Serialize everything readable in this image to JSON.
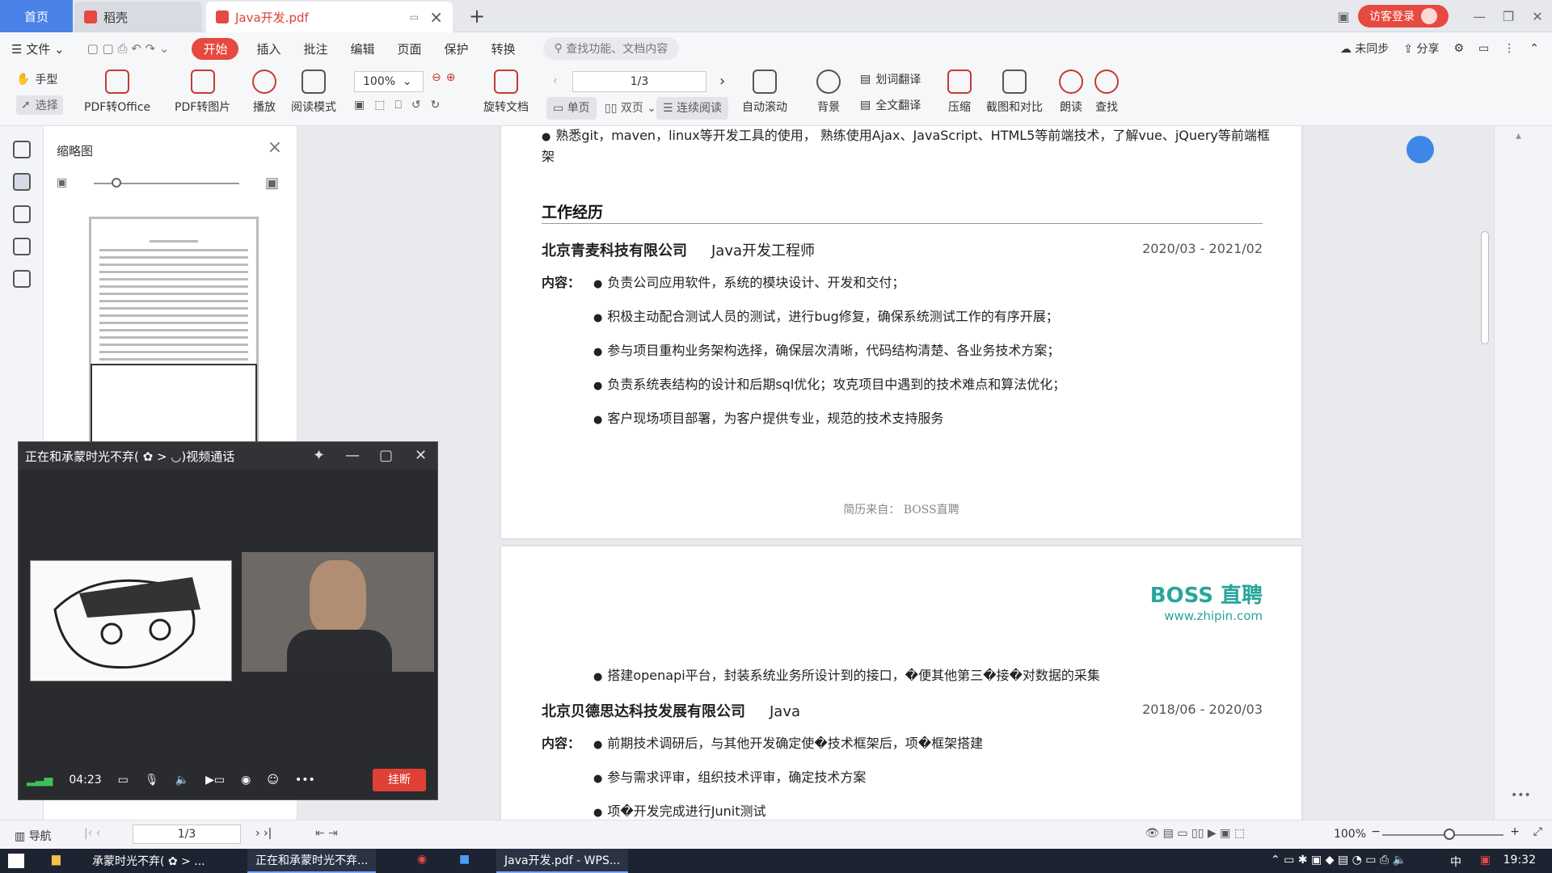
{
  "tabs": {
    "home": "首页",
    "daoke": "稻壳",
    "pdf": "Java开发.pdf",
    "guest_login": "访客登录"
  },
  "menu": {
    "file": "文件",
    "items": [
      "开始",
      "插入",
      "批注",
      "编辑",
      "页面",
      "保护",
      "转换"
    ],
    "search_placeholder": "查找功能、文档内容",
    "sync": "未同步",
    "share": "分享"
  },
  "ribbon": {
    "hand": "手型",
    "select": "选择",
    "pdf_office": "PDF转Office",
    "pdf_image": "PDF转图片",
    "play": "播放",
    "read_mode": "阅读模式",
    "zoom": "100%",
    "page": "1/3",
    "rotate": "旋转文档",
    "single": "单页",
    "double": "双页",
    "continuous": "连续阅读",
    "auto_scroll": "自动滚动",
    "background": "背景",
    "word_translate": "划词翻译",
    "full_translate": "全文翻译",
    "compress": "压缩",
    "screenshot_compare": "截图和对比",
    "read_aloud": "朗读",
    "find": "查找"
  },
  "thumbnails": {
    "title": "缩略图"
  },
  "call": {
    "title": "正在和承蒙时光不弃( ✿ > ◡)视频通话",
    "duration": "04:23",
    "hangup": "挂断"
  },
  "doc": {
    "skill_line": "熟悉git，maven，linux等开发工具的使用， 熟练使用Ajax、JavaScript、HTML5等前端技术，了解vue、jQuery等前端框",
    "skill_line_cont": "架",
    "section_title": "工作经历",
    "job1": {
      "company": "北京青麦科技有限公司",
      "role": "Java开发工程师",
      "dates": "2020/03 - 2021/02",
      "content_label": "内容：",
      "bullets": [
        "负责公司应用软件，系统的模块设计、开发和交付；",
        "积极主动配合测试人员的测试，进行bug修复，确保系统测试工作的有序开展；",
        "参与项目重构业务架构选择，确保层次清晰，代码结构清楚、各业务技术方案；",
        "负责系统表结构的设计和后期sql优化；攻克项目中遇到的技术难点和算法优化；",
        "客户现场项目部署，为客户提供专业，规范的技术支持服务"
      ]
    },
    "from": "简历来自： BOSS直聘",
    "boss_logo": "BOSS 直聘",
    "boss_url": "www.zhipin.com",
    "job1_extra": "搭建openapi平台，封装系统业务所设计到的接口，�便其他第三�接�对数据的采集",
    "job2": {
      "company": "北京贝德思达科技发展有限公司",
      "role": "Java",
      "dates": "2018/06 - 2020/03",
      "content_label": "内容：",
      "bullets": [
        "前期技术调研后，与其他开发确定使�技术框架后，项�框架搭建",
        "参与需求评审，组织技术评审，确定技术方案",
        "项�开发完成进行Junit测试"
      ]
    }
  },
  "status": {
    "nav": "导航",
    "page": "1/3",
    "zoom": "100%"
  },
  "taskbar": {
    "items": [
      "承蒙时光不弃( ✿ > ...",
      "正在和承蒙时光不弃...",
      "Java开发.pdf - WPS..."
    ],
    "ime": "中",
    "clock": "19:32"
  },
  "colors": {
    "accent_red": "#e5493f",
    "accent_blue": "#4b82e8",
    "boss_green": "#28a59b"
  }
}
